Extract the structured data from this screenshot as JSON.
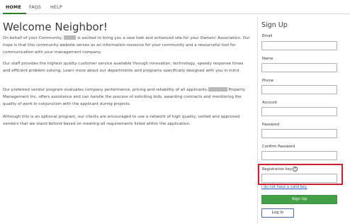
{
  "nav": {
    "items": [
      "HOME",
      "FAQS",
      "HELP"
    ],
    "active": "HOME"
  },
  "main": {
    "title": "Welcome Neighbor!",
    "p1": {
      "before": "On behalf of your Community,",
      "after": "is excited to bring you a new look and enhanced site for your Owners' Association. Our hope is that this community website serves as an information resource for your community and a resourceful tool for communication with your management company."
    },
    "p2": "Our staff provides the highest quality customer service available through innovation, technology, speedy response times and efficient problem solving. Learn more about our departments and programs specifically designed with you in mind.",
    "p3": {
      "before": "Our preferred vendor program evaluates company performance, pricing and reliability of all applicants.",
      "after": "Property Management Inc. offers assistance and can handle the process of soliciting bids, awarding contracts and monitoring the quality of work in conjunction with the applicant during projects."
    },
    "p4": "Although this is an optional program, our clients are encouraged to use a network of high quality, vetted and approved vendors that we stand behind based on meeting all requirements listed within the application."
  },
  "signup": {
    "title": "Sign Up",
    "fields": {
      "email": {
        "label": "Email",
        "value": ""
      },
      "name": {
        "label": "Name",
        "value": ""
      },
      "phone": {
        "label": "Phone",
        "value": ""
      },
      "account": {
        "label": "Account",
        "value": ""
      },
      "password": {
        "label": "Password",
        "value": ""
      },
      "confirm_password": {
        "label": "Confirm Password",
        "value": ""
      },
      "registration_key": {
        "label": "Registration key",
        "value": ""
      }
    },
    "help_icon": "?",
    "no_key_link": "I do not have a valid key.",
    "signup_button": "Sign Up",
    "login_button": "Log In"
  },
  "colors": {
    "accent": "#43a047",
    "nav_underline": "#2e7d32",
    "highlight": "#cc1f2d",
    "link": "#2060b8"
  },
  "icons": {
    "help": "question-circle-icon"
  }
}
